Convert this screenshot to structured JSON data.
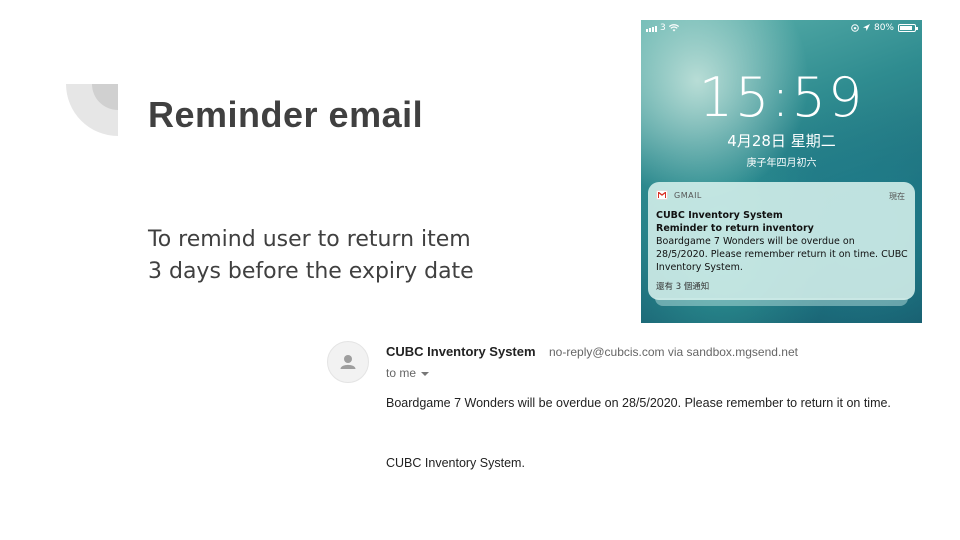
{
  "slide": {
    "title": "Reminder email",
    "body_lines": [
      "To remind user to return item",
      "3 days before the expiry date"
    ],
    "accent_color": "#404040",
    "deco_color": "#d9d9d9"
  },
  "phone": {
    "status": {
      "carrier": "3",
      "battery": "80%",
      "icons": [
        "signal-icon",
        "wifi-icon",
        "lock-rotation-icon",
        "location-icon",
        "battery-icon"
      ]
    },
    "time": "15:59",
    "date": "4月28日 星期二",
    "lunar_date": "庚子年四月初六",
    "notification": {
      "app": "GMAIL",
      "timestamp": "現在",
      "sender": "CUBC Inventory System",
      "subject": "Reminder to return inventory",
      "message": "Boardgame 7 Wonders will be overdue on 28/5/2020. Please remember return it on time. CUBC Inventory System.",
      "more": "還有 3 個通知"
    }
  },
  "email": {
    "sender_name": "CUBC Inventory System",
    "sender_address": "no-reply@cubcis.com via sandbox.mgsend.net",
    "recipient": "to me",
    "body": "Boardgame 7 Wonders will be overdue on 28/5/2020. Please remember to return it on time.",
    "signature": "CUBC Inventory System."
  }
}
